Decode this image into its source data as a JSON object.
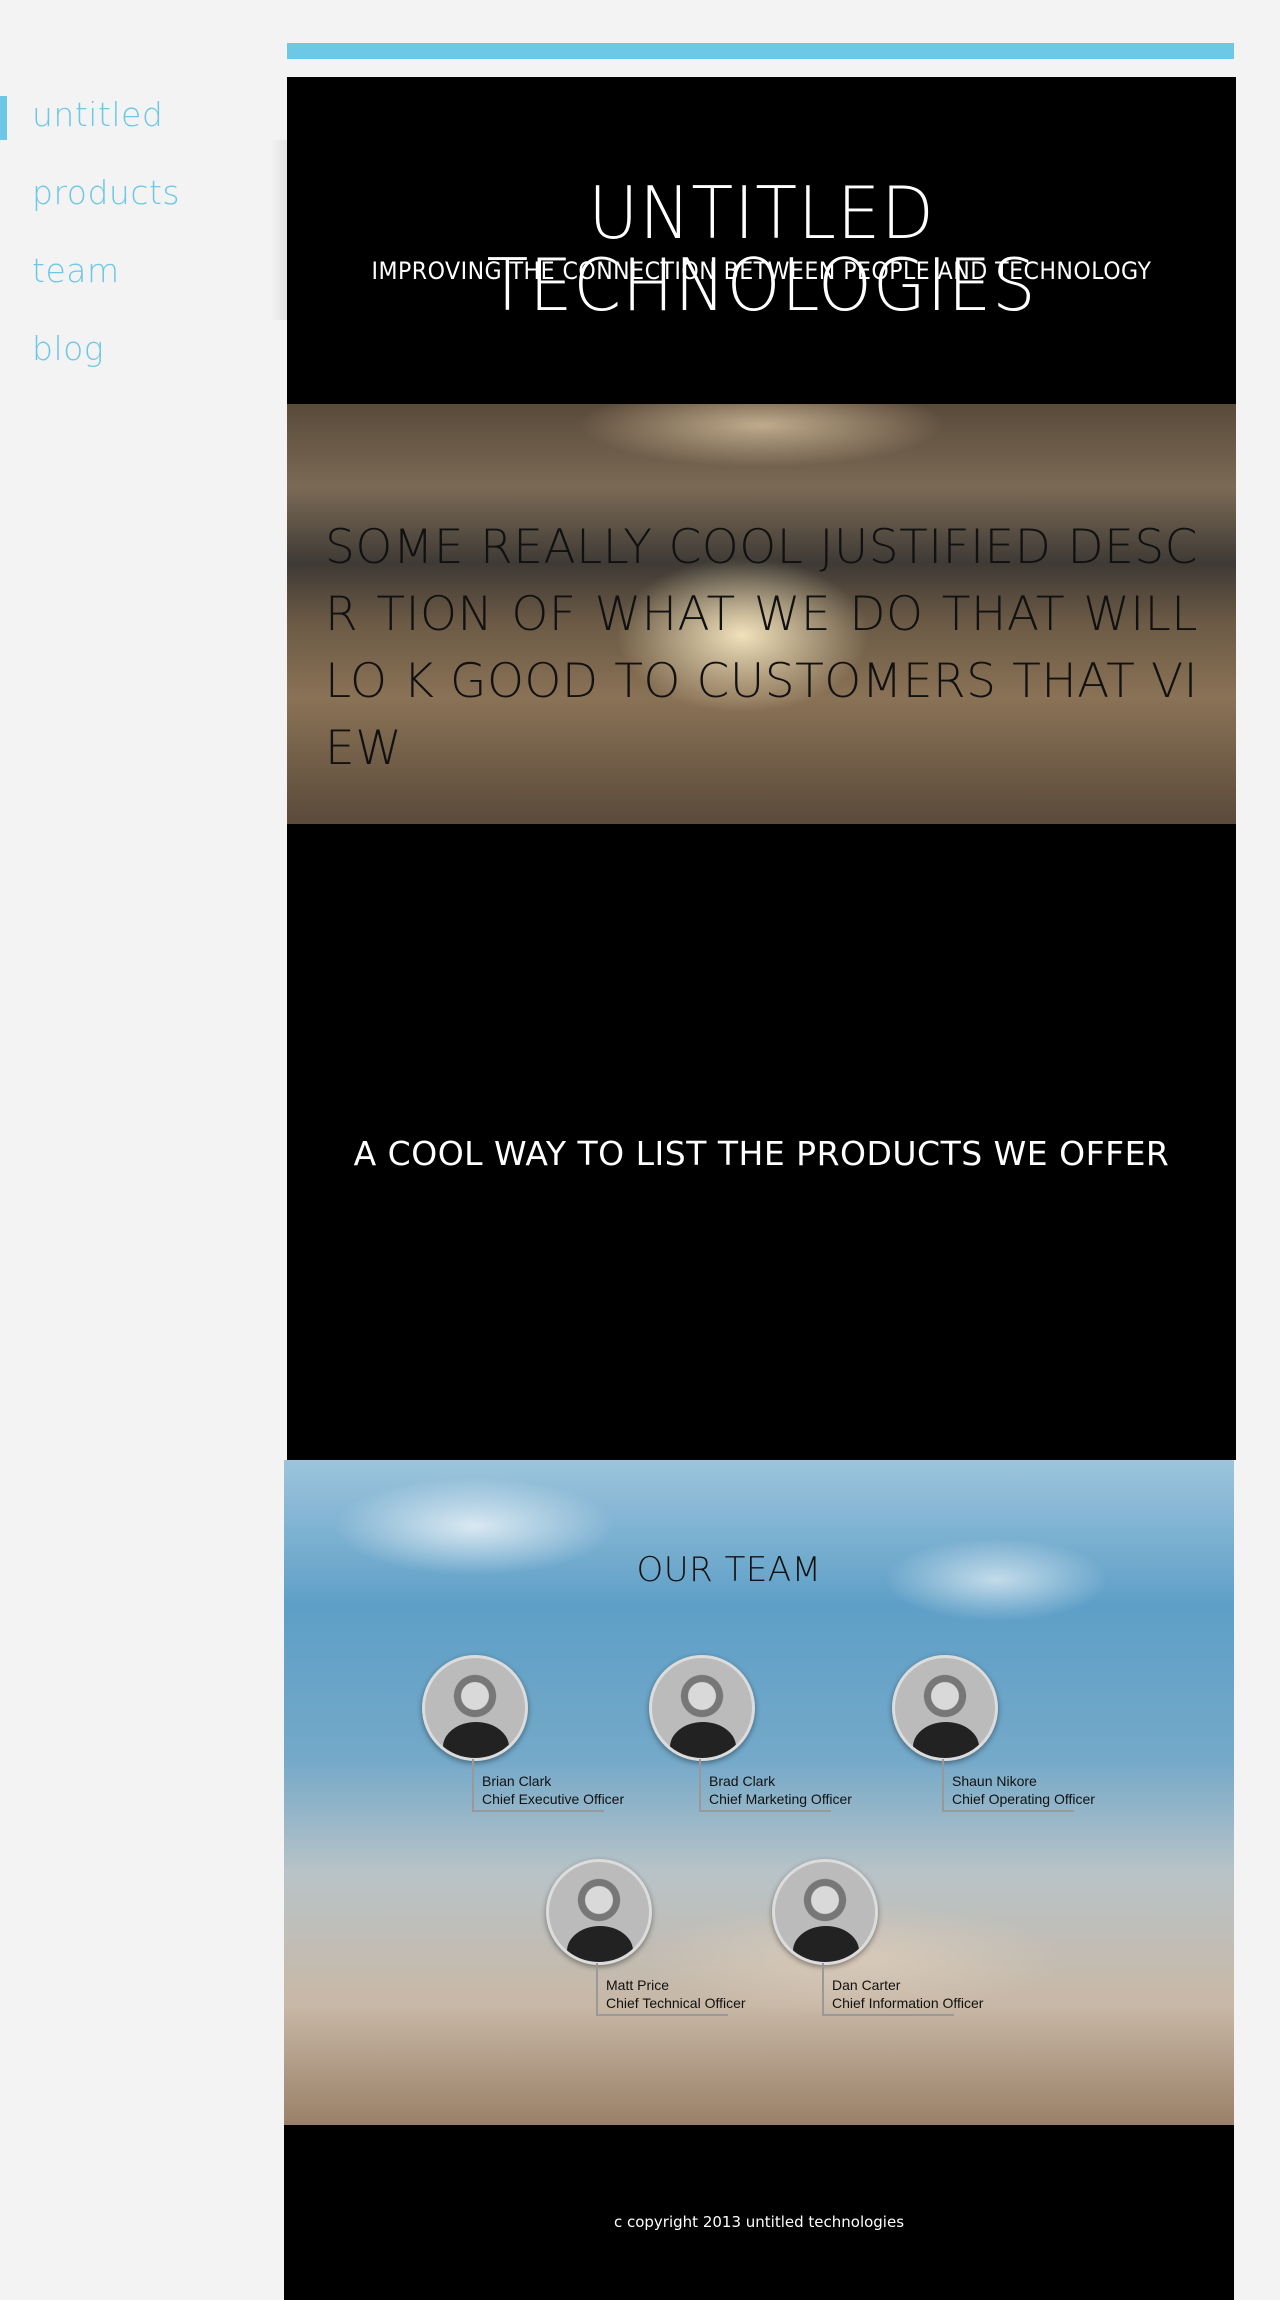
{
  "nav": {
    "items": [
      {
        "label": "untitled",
        "active": true
      },
      {
        "label": "products",
        "active": false
      },
      {
        "label": "team",
        "active": false
      },
      {
        "label": "blog",
        "active": false
      }
    ]
  },
  "header": {
    "title": "UNTITLED TECHNOLOGIES",
    "subtitle": "IMPROVING THE CONNECTION BETWEEN PEOPLE AND TECHNOLOGY"
  },
  "hero": {
    "text": "SOME REALLY COOL JUSTIFIED DESCR TION OF WHAT WE DO THAT WILL LO K GOOD TO CUSTOMERS THAT VIEW"
  },
  "products": {
    "heading": "A COOL WAY TO LIST THE PRODUCTS WE OFFER"
  },
  "team": {
    "heading": "OUR TEAM",
    "members": [
      {
        "name": "Brian Clark",
        "role": "Chief Executive Officer"
      },
      {
        "name": "Brad Clark",
        "role": "Chief Marketing Officer"
      },
      {
        "name": "Shaun Nikore",
        "role": "Chief Operating Officer"
      },
      {
        "name": "Matt Price",
        "role": "Chief Technical Officer"
      },
      {
        "name": "Dan Carter",
        "role": "Chief Information Officer"
      }
    ]
  },
  "footer": {
    "text": "c copyright 2013 untitled technologies"
  },
  "colors": {
    "accent": "#6dc7e6",
    "background": "#f3f3f3",
    "section_dark": "#000000"
  }
}
